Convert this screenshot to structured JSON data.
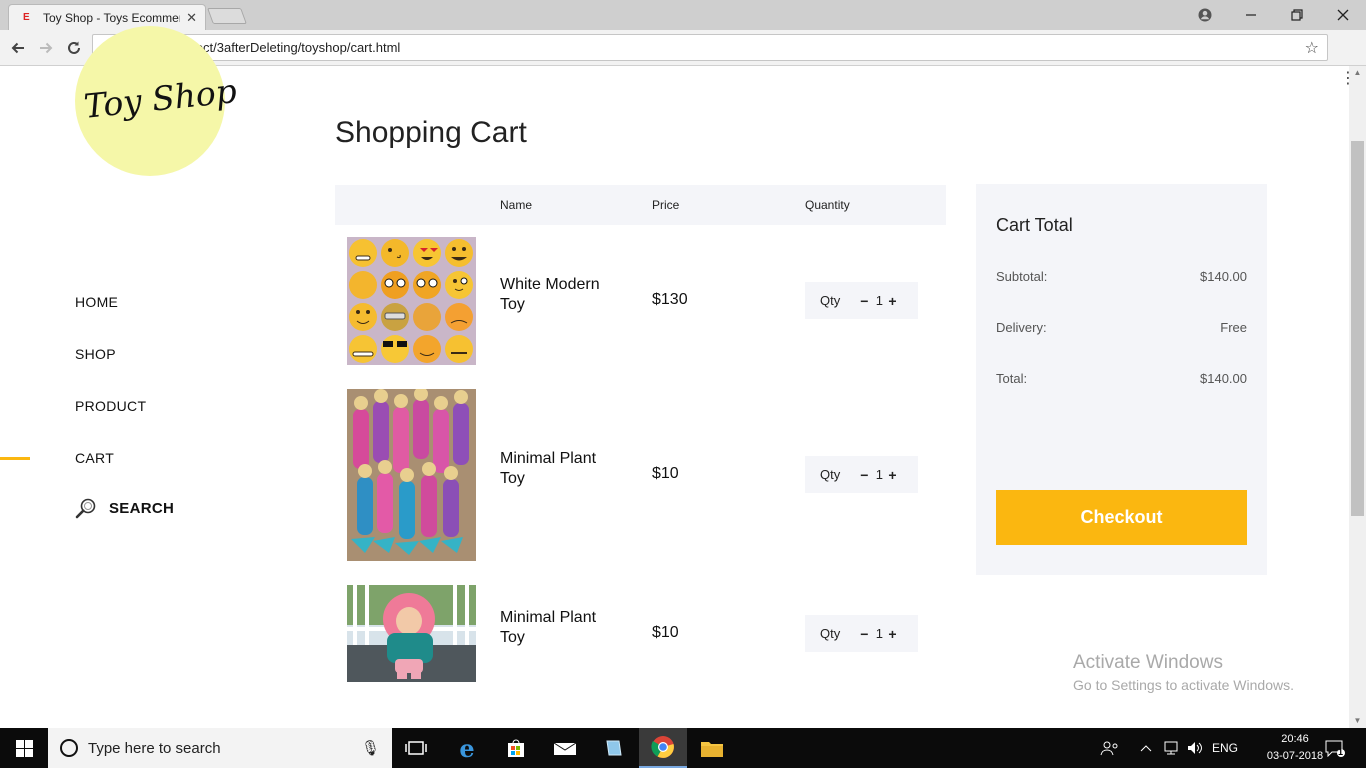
{
  "browser": {
    "tab_title": "Toy Shop - Toys Ecommerce",
    "tab_favicon": "E",
    "url": "file:///D:/Project/3afterDeleting/toyshop/cart.html"
  },
  "site": {
    "logo_text": "Toy Shop",
    "nav": [
      {
        "label": "HOME"
      },
      {
        "label": "SHOP"
      },
      {
        "label": "PRODUCT"
      },
      {
        "label": "CART",
        "active": true
      }
    ],
    "search_label": "SEARCH",
    "accent_color": "#fbb710"
  },
  "cart": {
    "title": "Shopping Cart",
    "columns": {
      "name": "Name",
      "price": "Price",
      "quantity": "Quantity"
    },
    "items": [
      {
        "name": "White Modern Toy",
        "price": "$130",
        "qty_label": "Qty",
        "qty": "1",
        "image": "emoji-plush-toys-grid"
      },
      {
        "name": "Minimal Plant Toy",
        "price": "$10",
        "qty_label": "Qty",
        "qty": "1",
        "image": "mermaid-dolls-collection"
      },
      {
        "name": "Minimal Plant Toy",
        "price": "$10",
        "qty_label": "Qty",
        "qty": "1",
        "image": "pink-hair-doll"
      }
    ]
  },
  "summary": {
    "title": "Cart Total",
    "subtotal_label": "Subtotal:",
    "subtotal": "$140.00",
    "delivery_label": "Delivery:",
    "delivery": "Free",
    "total_label": "Total:",
    "total": "$140.00",
    "checkout_label": "Checkout"
  },
  "watermark": {
    "line1": "Activate Windows",
    "line2": "Go to Settings to activate Windows."
  },
  "taskbar": {
    "search_placeholder": "Type here to search",
    "language": "ENG",
    "time": "20:46",
    "date": "03-07-2018",
    "notification_count": "1"
  }
}
